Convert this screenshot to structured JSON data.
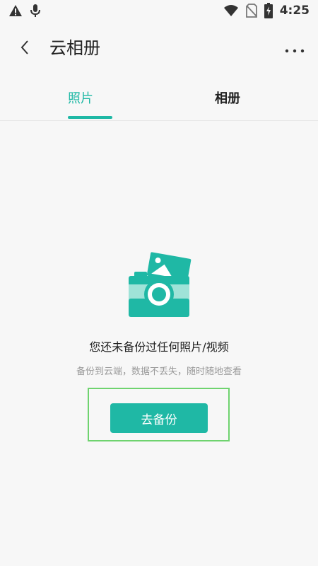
{
  "status_bar": {
    "time": "4:25",
    "icons": [
      "alert-icon",
      "microphone-icon",
      "wifi-icon",
      "no-sim-icon",
      "battery-charging-icon"
    ]
  },
  "app_bar": {
    "title": "云相册",
    "back_icon": "chevron-left-icon",
    "more_icon": "more-dots-icon"
  },
  "tabs": [
    {
      "label": "照片",
      "selected": true
    },
    {
      "label": "相册",
      "selected": false
    }
  ],
  "empty_state": {
    "illustration": "camera-with-photo-icon",
    "title": "您还未备份过任何照片/视频",
    "subtitle": "备份到云端，数据不丢失，随时随地查看",
    "button_label": "去备份"
  },
  "colors": {
    "accent": "#1fb8a5",
    "background": "#f7f7f7",
    "illustration_light": "#9fe3d8",
    "highlight_box": "#6fd36f"
  }
}
